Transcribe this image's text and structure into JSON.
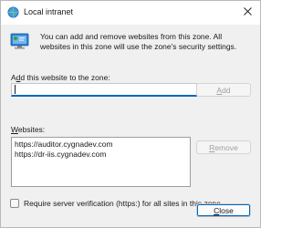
{
  "window": {
    "title": "Local intranet",
    "icon": "globe-icon",
    "close_icon": "close-icon"
  },
  "info": {
    "icon": "zone-monitor-icon",
    "text": "You can add and remove websites from this zone. All websites in this zone will use the zone's security settings."
  },
  "add_section": {
    "label_prefix": "A",
    "label_accel": "d",
    "label_suffix": "d this website to the zone:",
    "input_value": "",
    "add_button_label": "Add",
    "add_button_accel": "A",
    "add_button_rest": "dd"
  },
  "websites": {
    "label_accel": "W",
    "label_rest": "ebsites:",
    "items": [
      "https://auditor.cygnadev.com",
      "https://dr-iis.cygnadev.com"
    ],
    "remove_button_accel": "R",
    "remove_button_rest": "emove"
  },
  "verification": {
    "checked": false,
    "label": "Require server verification (https:) for all sites in this zone"
  },
  "footer": {
    "close_button_accel": "C",
    "close_button_rest": "lose"
  },
  "colors": {
    "accent": "#0067c0",
    "window_bg": "#f0f0f0",
    "titlebar_bg": "#ffffff"
  }
}
